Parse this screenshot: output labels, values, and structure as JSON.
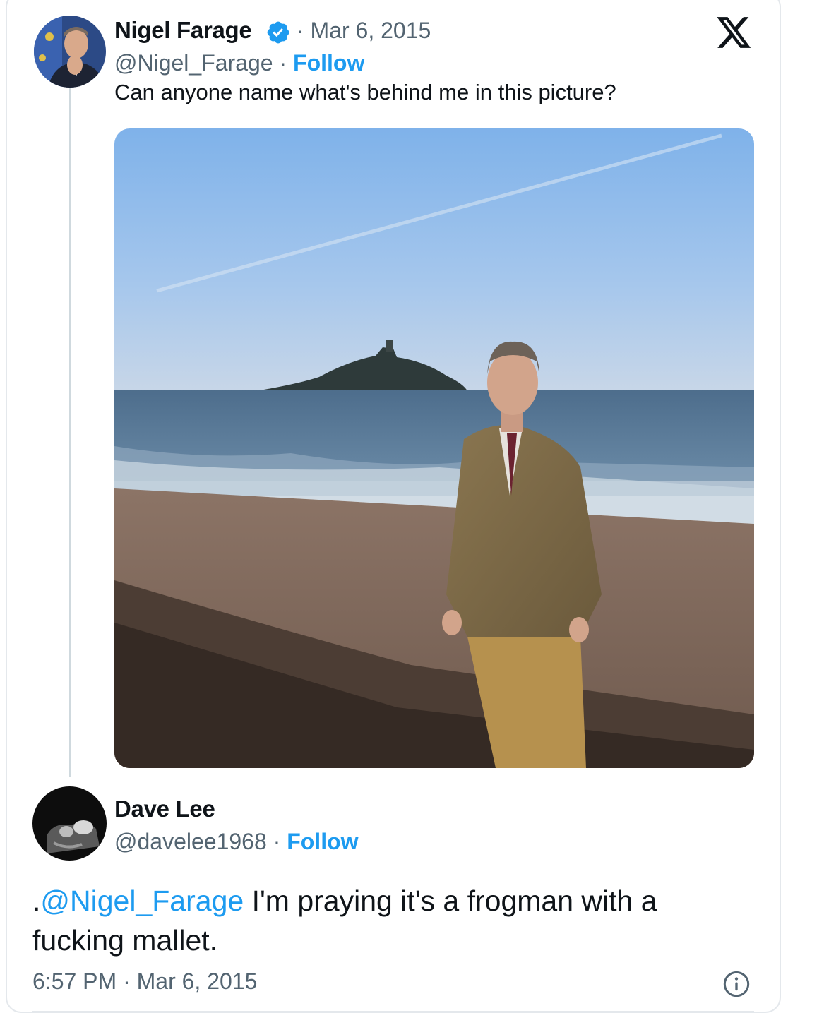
{
  "original_tweet": {
    "author_name": "Nigel Farage",
    "verified_icon": "verified-badge-icon",
    "date": "· Mar 6, 2015",
    "handle": "@Nigel_Farage",
    "separator": " · ",
    "follow_label": "Follow",
    "text": "Can anyone name what's behind me in this picture?"
  },
  "platform_logo": "x-logo-icon",
  "reply": {
    "author_name": "Dave Lee",
    "handle": "@davelee1968",
    "separator": " · ",
    "follow_label": "Follow",
    "text_prefix": ".",
    "mention": "@Nigel_Farage",
    "text_body": " I'm praying it's a frogman with a fucking mallet.",
    "timestamp": "6:57 PM · Mar 6, 2015",
    "info_icon": "info-icon"
  },
  "colors": {
    "link": "#1d9bf0",
    "secondary_text": "#536471",
    "primary_text": "#0f1419"
  }
}
